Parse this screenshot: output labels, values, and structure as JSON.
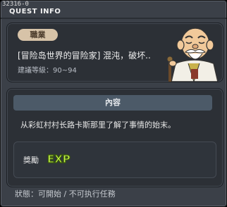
{
  "debug_id": "32316-0",
  "title": "QUEST INFO",
  "quest": {
    "tag": "職業",
    "name": "[冒险岛世界的冒险家] 混沌，破坏..",
    "level": "建議等級：90~94"
  },
  "section": {
    "header": "內容",
    "description": "从彩虹村村长路卡斯那里了解了事情的始末。"
  },
  "reward": {
    "label": "獎勵",
    "exp_text": "EXP"
  },
  "status": "狀態：可開始 / 不可执行任務",
  "colors": {
    "accent_green": "#c6f44a",
    "panel": "#2c3036",
    "header_bg": "#4c5a68"
  },
  "icons": [
    "old-man-avatar-icon",
    "exp-icon"
  ]
}
